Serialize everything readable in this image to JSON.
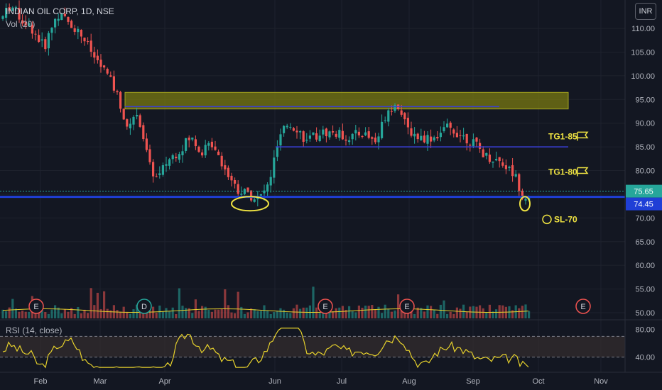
{
  "header": {
    "symbol_line": "INDIAN OIL CORP, 1D, NSE",
    "volume_label": "Vol (20)"
  },
  "currency_button": "INR",
  "rsi_label": "RSI (14, close)",
  "colors": {
    "up": "#26a69a",
    "down": "#ef5350",
    "support": "#1f3fd6",
    "zone": "#7a7a12",
    "annotation": "#f0e442",
    "rsi": "#e6d12c",
    "vol_ma": "#e6d12c"
  },
  "chart_data": {
    "type": "candlestick",
    "title": "INDIAN OIL CORP, 1D, NSE",
    "x_ticks": [
      "Feb",
      "Mar",
      "Apr",
      "Jun",
      "Jul",
      "Aug",
      "Sep",
      "Oct",
      "Nov"
    ],
    "y_ticks": [
      "110.00",
      "105.00",
      "100.00",
      "95.00",
      "90.00",
      "85.00",
      "80.00",
      "75.00",
      "70.00",
      "65.00",
      "60.00",
      "55.00",
      "50.00"
    ],
    "y_range": [
      48.5,
      116
    ],
    "last_price": "75.65",
    "support_price": "74.45",
    "resistance_zone": [
      93,
      96.5
    ],
    "resistance_line": 93.5,
    "mid_line": 85,
    "annotations": [
      {
        "label": "TG1-85",
        "price": 87.5,
        "icon": "flag-icon"
      },
      {
        "label": "TG1-80",
        "price": 80,
        "icon": "flag-icon"
      },
      {
        "label": "SL-70",
        "price": 70,
        "icon": "sad-face-icon"
      }
    ],
    "event_markers": [
      "E",
      "D",
      "E",
      "E",
      "E"
    ],
    "rsi": {
      "label": "RSI (14, close)",
      "ticks": [
        "80.00",
        "40.00"
      ],
      "upper_band": 70,
      "lower_band": 30
    },
    "volume": {
      "label": "Vol (20)"
    }
  }
}
